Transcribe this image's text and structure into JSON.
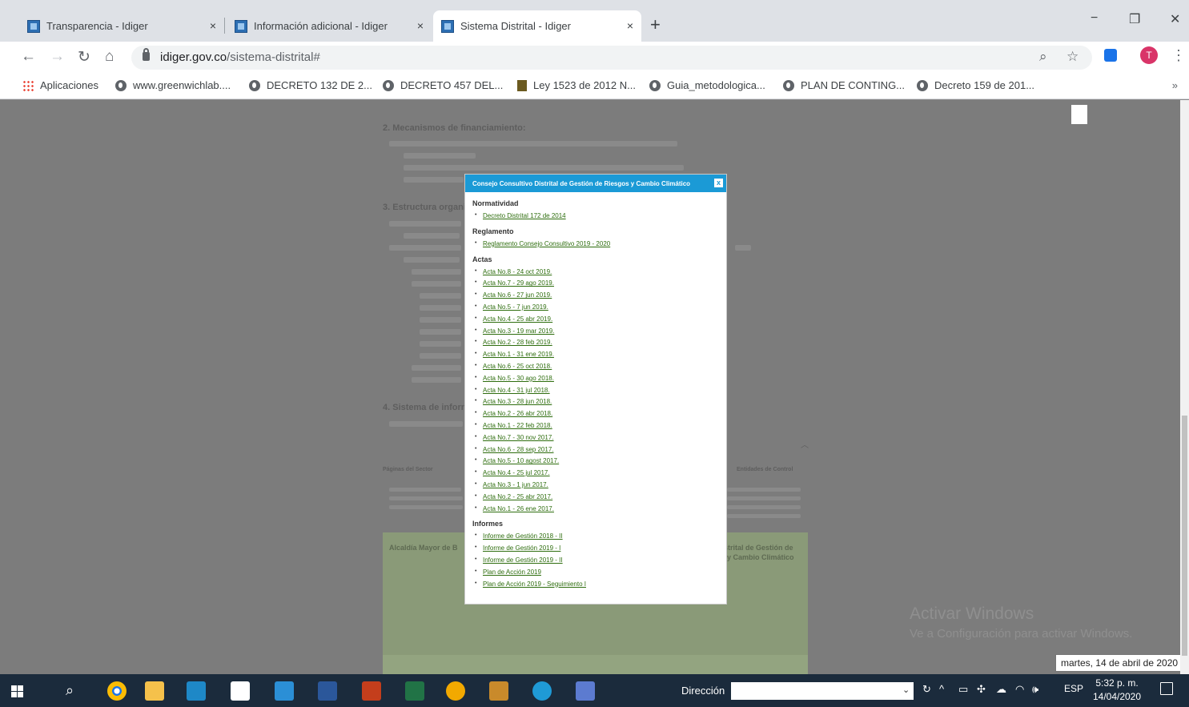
{
  "browser": {
    "tabs": [
      {
        "title": "Transparencia - Idiger",
        "close": "×"
      },
      {
        "title": "Información adicional - Idiger",
        "close": "×"
      },
      {
        "title": "Sistema Distrital - Idiger",
        "close": "×"
      }
    ],
    "new_tab": "+",
    "window_controls": {
      "minimize": "−",
      "restore": "❐",
      "close": "✕"
    },
    "url_domain": "idiger.gov.co",
    "url_path": "/sistema-distrital#",
    "avatar_letter": "T",
    "bookmarks": [
      "Aplicaciones",
      "www.greenwichlab....",
      "DECRETO 132 DE 2...",
      "DECRETO 457 DEL...",
      "Ley 1523 de 2012 N...",
      "Guia_metodologica...",
      "PLAN DE CONTING...",
      "Decreto 159 de 201..."
    ],
    "bookmarks_more": "»"
  },
  "background": {
    "headings": [
      "2. Mecanismos de financiamiento:",
      "3. Estructura organi",
      "4. Sistema de inforr"
    ],
    "footer_left_title": "Alcaldía Mayor de B",
    "footer_right_title": "strital de Gestión de",
    "footer_right_sub": "y Cambio Climático",
    "left_col_title": "Páginas del Sector",
    "right_col_title": "Entidades de Control"
  },
  "modal": {
    "title": "Consejo Consultivo Distrital de Gestión de Riesgos y Cambio Climático",
    "close": "x",
    "sections": [
      {
        "heading": "Normatividad",
        "links": [
          "Decreto Distrital 172 de 2014"
        ]
      },
      {
        "heading": "Reglamento",
        "links": [
          "Reglamento Consejo Consultivo 2019 - 2020"
        ]
      },
      {
        "heading": "Actas",
        "links": [
          "Acta No.8 - 24 oct 2019.",
          "Acta No.7 - 29 ago 2019.",
          "Acta No.6 - 27 jun 2019.",
          "Acta No.5 - 7 jun 2019.",
          "Acta No.4 - 25 abr 2019.",
          "Acta No.3 - 19 mar 2019.",
          "Acta No.2 - 28 feb 2019.",
          "Acta No.1 - 31 ene 2019.",
          "Acta No.6 - 25 oct 2018.",
          "Acta No.5 - 30 ago 2018.",
          "Acta No.4 - 31 jul 2018.",
          "Acta No.3 - 28 jun 2018.",
          "Acta No.2 - 26 abr 2018.",
          "Acta No.1 - 22 feb 2018.",
          "Acta No.7 - 30 nov 2017.",
          "Acta No.6 - 28 sep 2017.",
          "Acta No.5 - 10 agost 2017.",
          "Acta No.4 - 25 jul 2017.",
          "Acta No.3 - 1 jun 2017.",
          "Acta No.2 - 25 abr 2017.",
          "Acta No.1 - 26 ene 2017."
        ]
      },
      {
        "heading": "Informes",
        "links": [
          "Informe de Gestión 2018 - II",
          "Informe de Gestión 2019 - I",
          "Informe de Gestión 2019 - II",
          "Plan de Acción 2019",
          "Plan de Acción 2019 - Seguimiento I"
        ]
      }
    ]
  },
  "windows": {
    "watermark_title": "Activar Windows",
    "watermark_sub": "Ve a Configuración para activar Windows.",
    "date_tooltip": "martes, 14 de abril de 2020",
    "address_label": "Dirección",
    "language": "ESP",
    "time": "5:32 p. m.",
    "date": "14/04/2020"
  }
}
